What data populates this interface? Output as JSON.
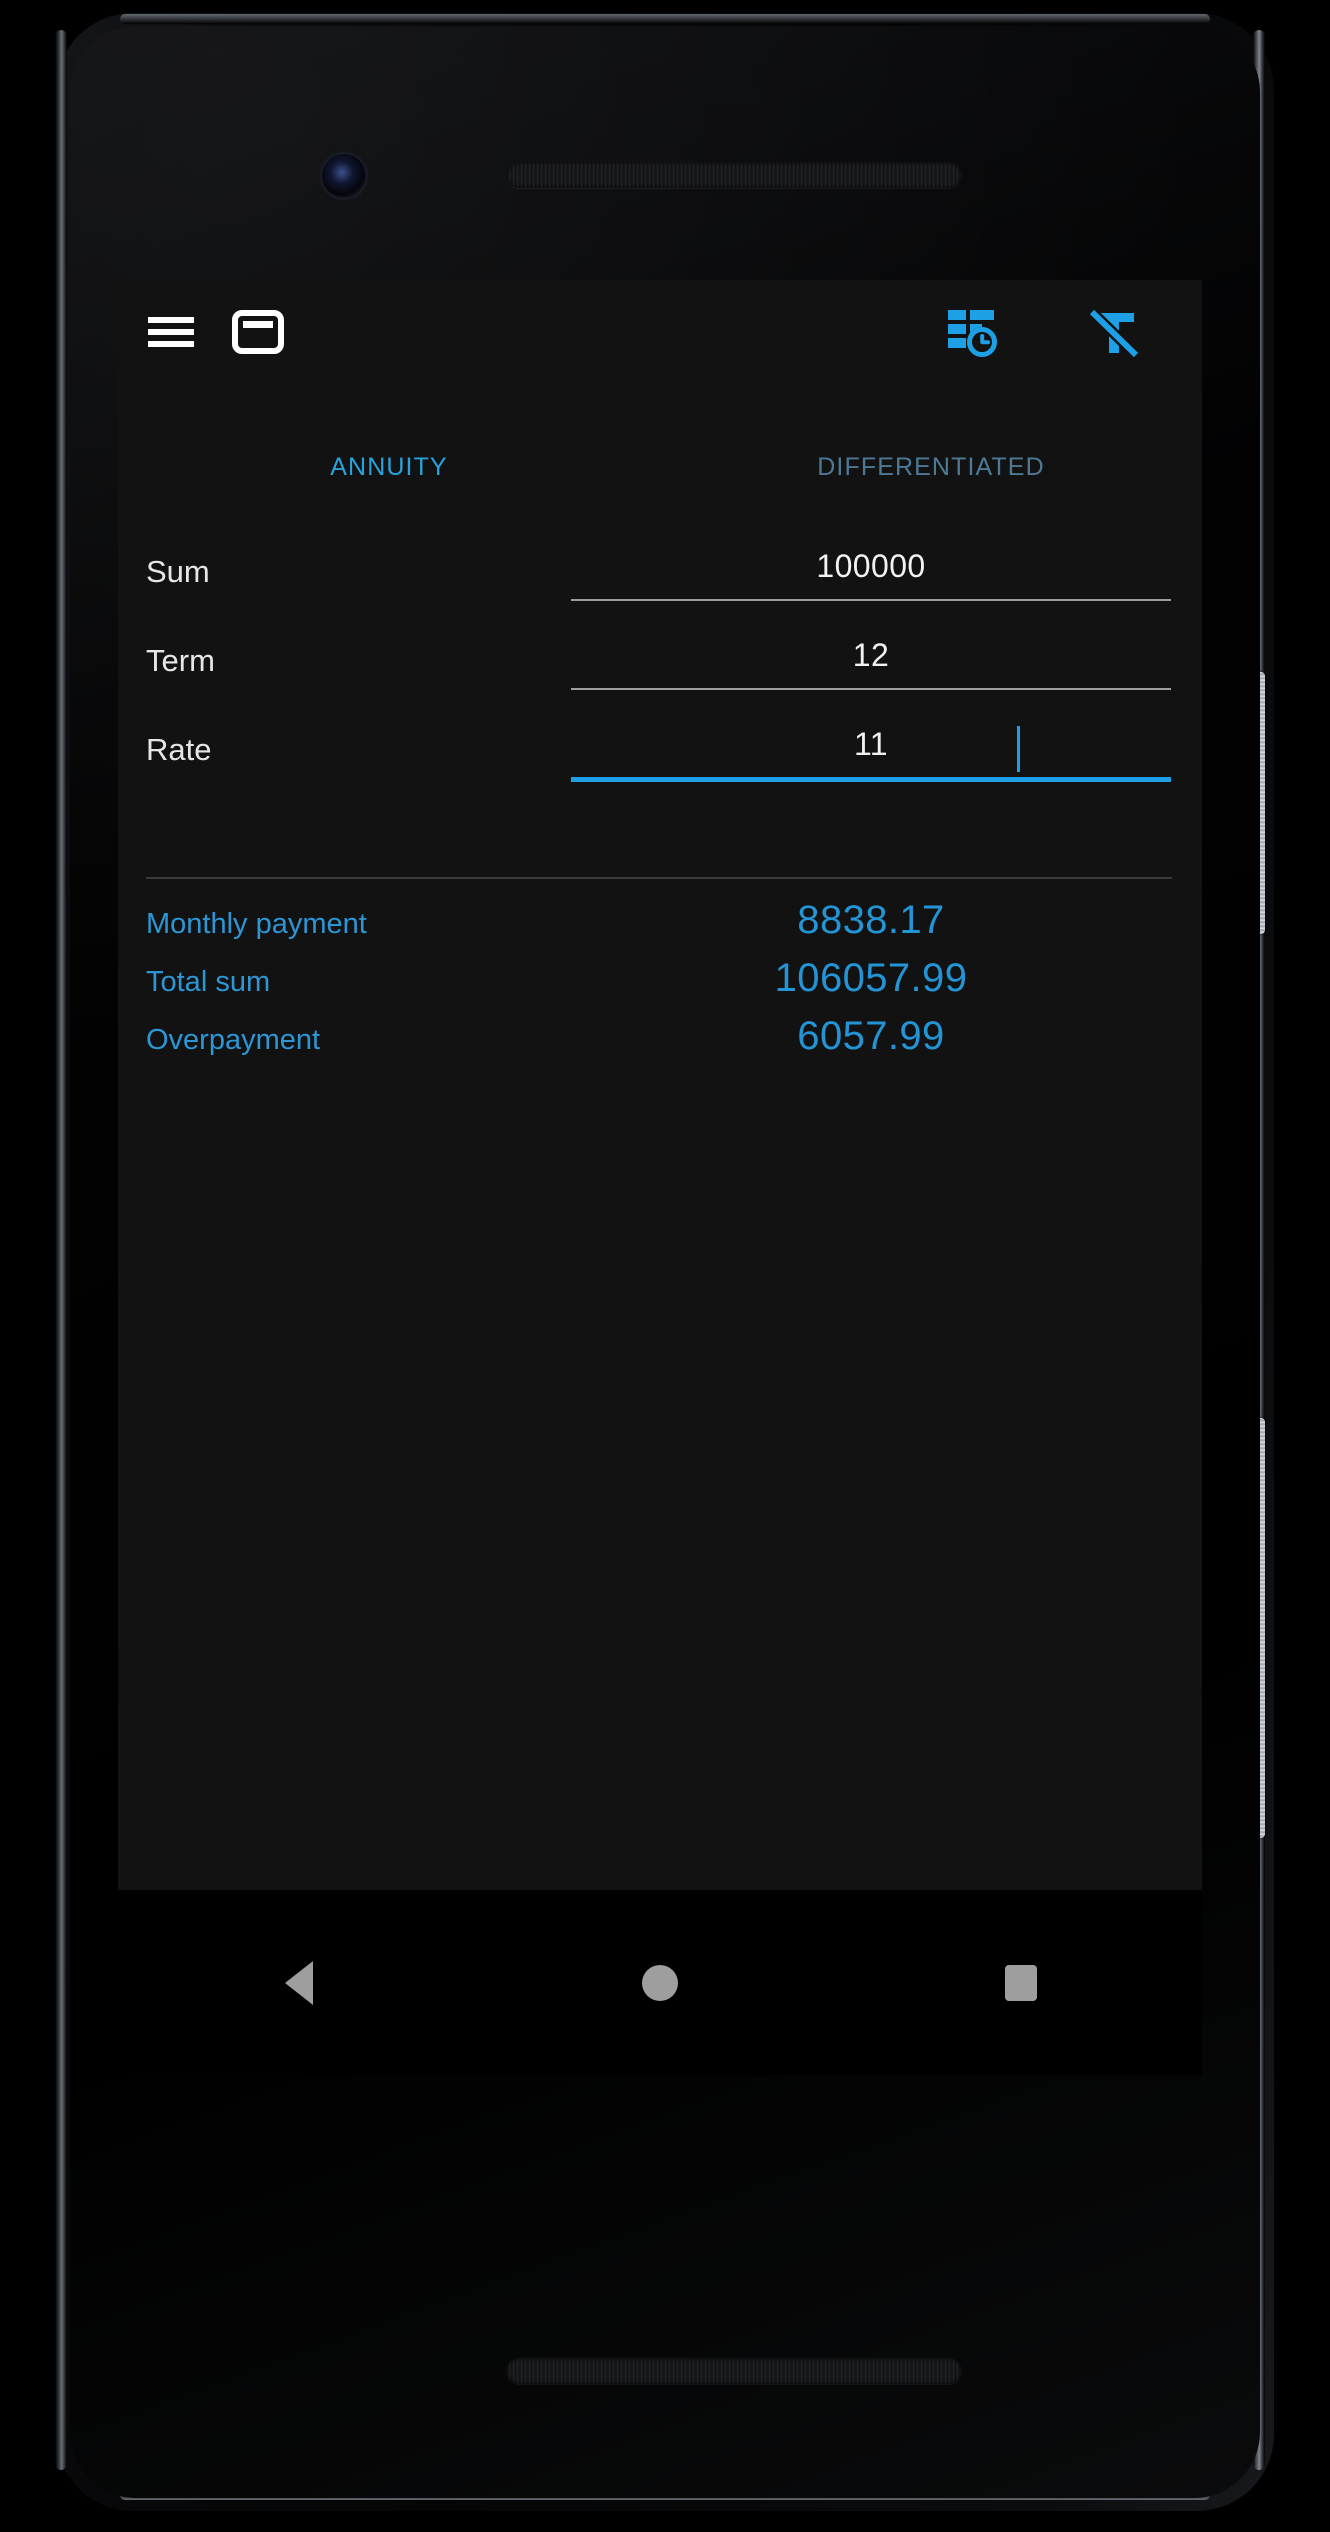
{
  "app": {
    "background": "#121212",
    "accent": "#2196F3",
    "accent_bright": "#29A3DC",
    "accent_muted": "#4E7995"
  },
  "toolbar": {
    "menu_icon": "hamburger-menu-icon",
    "card_icon": "credit-card-icon",
    "schedule_icon": "payment-schedule-table-clock-icon",
    "clear_icon": "clear-format-icon",
    "menu_label": "Menu",
    "card_label": "Loan card",
    "schedule_label": "Payment schedule",
    "clear_label": "Clear fields"
  },
  "tabs": [
    {
      "label": "ANNUITY",
      "active": true
    },
    {
      "label": "DIFFERENTIATED",
      "active": false
    }
  ],
  "fields": [
    {
      "label": "Sum",
      "value": "100000",
      "placeholder": "Sum",
      "focused": false
    },
    {
      "label": "Term",
      "value": "12",
      "placeholder": "Term",
      "focused": false
    },
    {
      "label": "Rate",
      "value": "11",
      "placeholder": "Rate",
      "focused": true
    }
  ],
  "results": [
    {
      "label": "Monthly payment",
      "value": "8838.17"
    },
    {
      "label": "Total sum",
      "value": "106057.99"
    },
    {
      "label": "Overpayment",
      "value": "6057.99"
    }
  ],
  "navbar": {
    "back_label": "Back",
    "home_label": "Home",
    "recents_label": "Recents"
  }
}
